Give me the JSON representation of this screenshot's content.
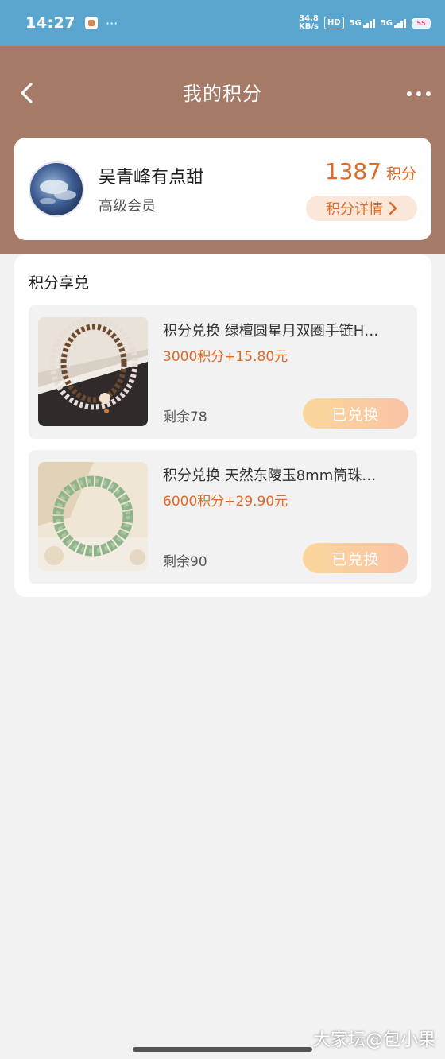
{
  "status_bar": {
    "time": "14:27",
    "more": "···",
    "net_speed_value": "34.8",
    "net_speed_unit": "KB/s",
    "hd_label": "HD",
    "signal1": "5G",
    "signal2": "5G",
    "battery": "55",
    "icons": [
      "app-notification-icon",
      "hd-voice-icon",
      "signal-icon",
      "signal-icon",
      "battery-icon"
    ]
  },
  "header": {
    "title": "我的积分",
    "back_icon": "chevron-left-icon",
    "more_icon": "more-dots-icon"
  },
  "user": {
    "name": "吴青峰有点甜",
    "level": "高级会员",
    "points": "1387",
    "points_unit": "积分",
    "detail_button": "积分详情"
  },
  "exchange": {
    "title": "积分享兑",
    "items": [
      {
        "name": "积分兑换 绿檀圆星月双圈手链H…",
        "price": "3000积分+15.80元",
        "stock": "剩余78",
        "button": "已兑换"
      },
      {
        "name": "积分兑换 天然东陵玉8mm筒珠…",
        "price": "6000积分+29.90元",
        "stock": "剩余90",
        "button": "已兑换"
      }
    ]
  },
  "watermark": "大家坛@包小果",
  "colors": {
    "status_bar": "#5aa6cf",
    "header": "#a57a66",
    "accent": "#e06a25",
    "button_gradient_start": "#fbd79a",
    "button_gradient_end": "#f9c3a6"
  }
}
